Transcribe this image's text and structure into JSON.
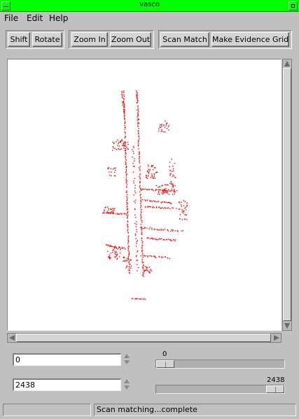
{
  "window": {
    "title": "vasco"
  },
  "menubar": {
    "items": [
      {
        "label": "File"
      },
      {
        "label": "Edit"
      },
      {
        "label": "Help"
      }
    ]
  },
  "toolbar": {
    "shift_label": "Shift",
    "rotate_label": "Rotate",
    "zoom_in_label": "Zoom In",
    "zoom_out_label": "Zoom Out",
    "scan_match_label": "Scan Match",
    "evidence_grid_label": "Make Evidence Grid"
  },
  "controls": {
    "start_value": "0",
    "end_value": "2438",
    "start_slider": {
      "label": "0",
      "value": 0,
      "max": 2438
    },
    "end_slider": {
      "label": "2438",
      "value": 2438,
      "max": 2438
    }
  },
  "status": {
    "left": "",
    "message": "Scan matching...complete"
  },
  "colors": {
    "titlebar": "#00ff00",
    "scan_points": "#ff0000",
    "background": "#c0c0c0"
  },
  "icons": [
    "window-menu-icon",
    "maximize-icon",
    "scroll-up-icon",
    "scroll-down-icon",
    "scroll-left-icon",
    "scroll-right-icon",
    "spin-up-icon",
    "spin-down-icon"
  ]
}
